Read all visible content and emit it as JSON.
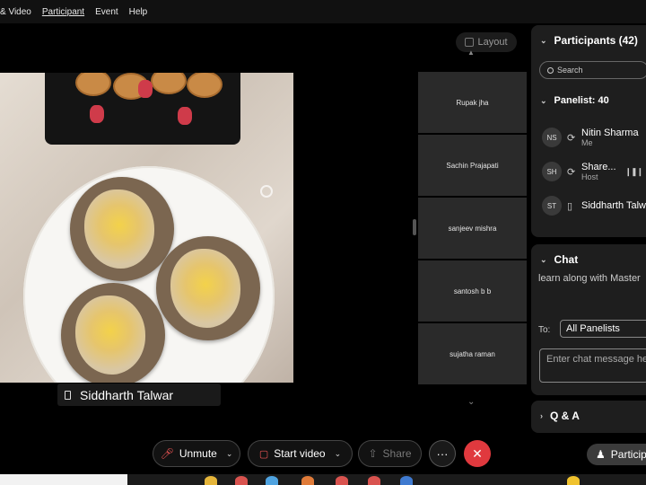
{
  "menubar": {
    "items": [
      "& Video",
      "Participant",
      "Event",
      "Help"
    ]
  },
  "stage": {
    "layout_label": "Layout",
    "active_speaker": "Siddharth Talwar",
    "tiles": [
      {
        "name": "Rupak jha"
      },
      {
        "name": "Sachin Prajapati"
      },
      {
        "name": "sanjeev mishra"
      },
      {
        "name": "santosh b b"
      },
      {
        "name": "sujatha raman"
      }
    ]
  },
  "panel": {
    "participants": {
      "title": "Participants (42)",
      "search_placeholder": "Search",
      "panelist_header": "Panelist: 40",
      "people": [
        {
          "initials": "NS",
          "name": "Nitin Sharma",
          "role": "Me"
        },
        {
          "initials": "SH",
          "name": "Share...",
          "role": "Host"
        },
        {
          "initials": "ST",
          "name": "Siddharth Talw",
          "role": ""
        }
      ]
    },
    "chat": {
      "title": "Chat",
      "last_message": "learn along with Master",
      "to_label": "To:",
      "to_value": "All Panelists",
      "input_placeholder": "Enter chat message he"
    },
    "qa": {
      "title": "Q & A"
    }
  },
  "toolbar": {
    "unmute_label": "Unmute",
    "start_video_label": "Start video",
    "share_label": "Share",
    "more_label": "···",
    "participants_label": "Particip"
  },
  "colors": {
    "leave": "#e0393e",
    "muted_icon": "#e55555",
    "panel_bg": "#1e1e1e"
  }
}
